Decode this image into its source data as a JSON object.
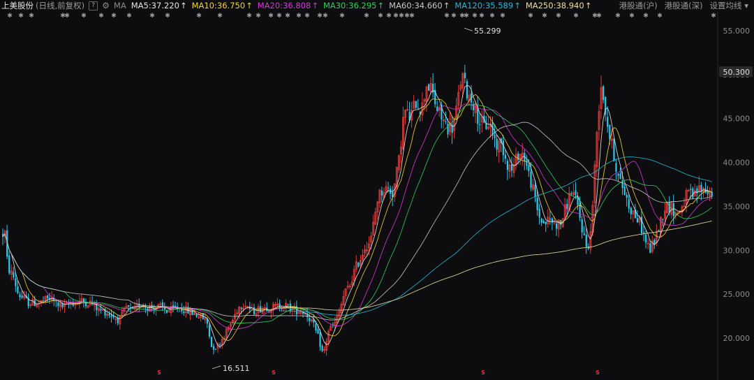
{
  "header": {
    "stock_name": "上美股份",
    "mode": "(日线,前复权)",
    "help": "?",
    "ma_label": "MA",
    "ma": [
      {
        "label": "MA5:37.220",
        "arrow": "↑",
        "color": "#e6e6e6"
      },
      {
        "label": "MA10:36.750",
        "arrow": "↑",
        "color": "#f0d43a"
      },
      {
        "label": "MA20:36.808",
        "arrow": "↑",
        "color": "#d637d6"
      },
      {
        "label": "MA30:36.295",
        "arrow": "↑",
        "color": "#2ed05a"
      },
      {
        "label": "MA60:34.660",
        "arrow": "↑",
        "color": "#c8c8c8"
      },
      {
        "label": "MA120:35.589",
        "arrow": "↑",
        "color": "#22b8d8"
      },
      {
        "label": "MA250:38.940",
        "arrow": "↑",
        "color": "#e8e2a0"
      }
    ],
    "links": [
      "港股通(沪)",
      "港股通(深)",
      "设置均线 ▾"
    ]
  },
  "chart_data": {
    "type": "candlestick",
    "y_ticks": [
      "55.000",
      "50.000",
      "45.000",
      "40.000",
      "35.000",
      "30.000",
      "25.000",
      "20.000"
    ],
    "ylim": [
      15.4,
      57.0
    ],
    "current_price": "50.300",
    "high_label": "55.299",
    "low_label": "16.511",
    "up_color": "#e03a3a",
    "down_color": "#2ec8ea",
    "anchors": [
      [
        0,
        30
      ],
      [
        5,
        33
      ],
      [
        10,
        28
      ],
      [
        18,
        27
      ],
      [
        25,
        25
      ],
      [
        40,
        24
      ],
      [
        55,
        24
      ],
      [
        70,
        24.5
      ],
      [
        90,
        23.5
      ],
      [
        100,
        24
      ],
      [
        115,
        24.2
      ],
      [
        130,
        24
      ],
      [
        140,
        23.2
      ],
      [
        150,
        23
      ],
      [
        160,
        22.5
      ],
      [
        170,
        22
      ],
      [
        180,
        23.5
      ],
      [
        190,
        23
      ],
      [
        200,
        24
      ],
      [
        210,
        23.5
      ],
      [
        220,
        23.5
      ],
      [
        230,
        23.5
      ],
      [
        240,
        23
      ],
      [
        255,
        23.5
      ],
      [
        270,
        23
      ],
      [
        285,
        22.5
      ],
      [
        295,
        22
      ],
      [
        302,
        19
      ],
      [
        310,
        19
      ],
      [
        318,
        20
      ],
      [
        325,
        21
      ],
      [
        332,
        22
      ],
      [
        340,
        23.5
      ],
      [
        350,
        24
      ],
      [
        360,
        23
      ],
      [
        375,
        23.5
      ],
      [
        390,
        23.5
      ],
      [
        405,
        23.8
      ],
      [
        420,
        23.2
      ],
      [
        435,
        23
      ],
      [
        445,
        22
      ],
      [
        455,
        20
      ],
      [
        462,
        18
      ],
      [
        470,
        21
      ],
      [
        478,
        21.5
      ],
      [
        485,
        23
      ],
      [
        492,
        25
      ],
      [
        500,
        26
      ],
      [
        508,
        28
      ],
      [
        515,
        29
      ],
      [
        522,
        30.5
      ],
      [
        530,
        31
      ],
      [
        540,
        36
      ],
      [
        548,
        37
      ],
      [
        555,
        37
      ],
      [
        562,
        36.5
      ],
      [
        570,
        40
      ],
      [
        578,
        46
      ],
      [
        586,
        45
      ],
      [
        595,
        47
      ],
      [
        603,
        46
      ],
      [
        610,
        49
      ],
      [
        618,
        48
      ],
      [
        625,
        46
      ],
      [
        632,
        45
      ],
      [
        640,
        44
      ],
      [
        648,
        44
      ],
      [
        655,
        47
      ],
      [
        660,
        50
      ],
      [
        668,
        48
      ],
      [
        676,
        47
      ],
      [
        684,
        45
      ],
      [
        692,
        44
      ],
      [
        700,
        44.5
      ],
      [
        710,
        42
      ],
      [
        718,
        42
      ],
      [
        725,
        40
      ],
      [
        733,
        39
      ],
      [
        741,
        41
      ],
      [
        749,
        41
      ],
      [
        755,
        39
      ],
      [
        762,
        37
      ],
      [
        770,
        34
      ],
      [
        778,
        33
      ],
      [
        786,
        33.5
      ],
      [
        794,
        33
      ],
      [
        802,
        33
      ],
      [
        810,
        35
      ],
      [
        818,
        37
      ],
      [
        826,
        35
      ],
      [
        834,
        32
      ],
      [
        840,
        30
      ],
      [
        845,
        32
      ],
      [
        850,
        38
      ],
      [
        855,
        45
      ],
      [
        860,
        49
      ],
      [
        866,
        46
      ],
      [
        872,
        43
      ],
      [
        878,
        41
      ],
      [
        885,
        38
      ],
      [
        892,
        37
      ],
      [
        900,
        35
      ],
      [
        908,
        34
      ],
      [
        916,
        33
      ],
      [
        924,
        31
      ],
      [
        930,
        30
      ],
      [
        936,
        31
      ],
      [
        944,
        33
      ],
      [
        952,
        35
      ],
      [
        960,
        35
      ],
      [
        968,
        34
      ],
      [
        976,
        35
      ],
      [
        984,
        36.5
      ],
      [
        992,
        36
      ],
      [
        1000,
        37
      ],
      [
        1008,
        37
      ],
      [
        1015,
        36.5
      ],
      [
        1023,
        37
      ]
    ],
    "ma_series": [
      {
        "name": "MA5",
        "color": "#e6e6e6",
        "window": 5
      },
      {
        "name": "MA10",
        "color": "#f0d43a",
        "window": 10
      },
      {
        "name": "MA20",
        "color": "#d637d6",
        "window": 20
      },
      {
        "name": "MA30",
        "color": "#2ed05a",
        "window": 30
      },
      {
        "name": "MA60",
        "color": "#c8c8c8",
        "window": 60
      },
      {
        "name": "MA120",
        "color": "#22b8d8",
        "window": 120
      },
      {
        "name": "MA250",
        "color": "#e8e2a0",
        "window": 250
      }
    ]
  }
}
